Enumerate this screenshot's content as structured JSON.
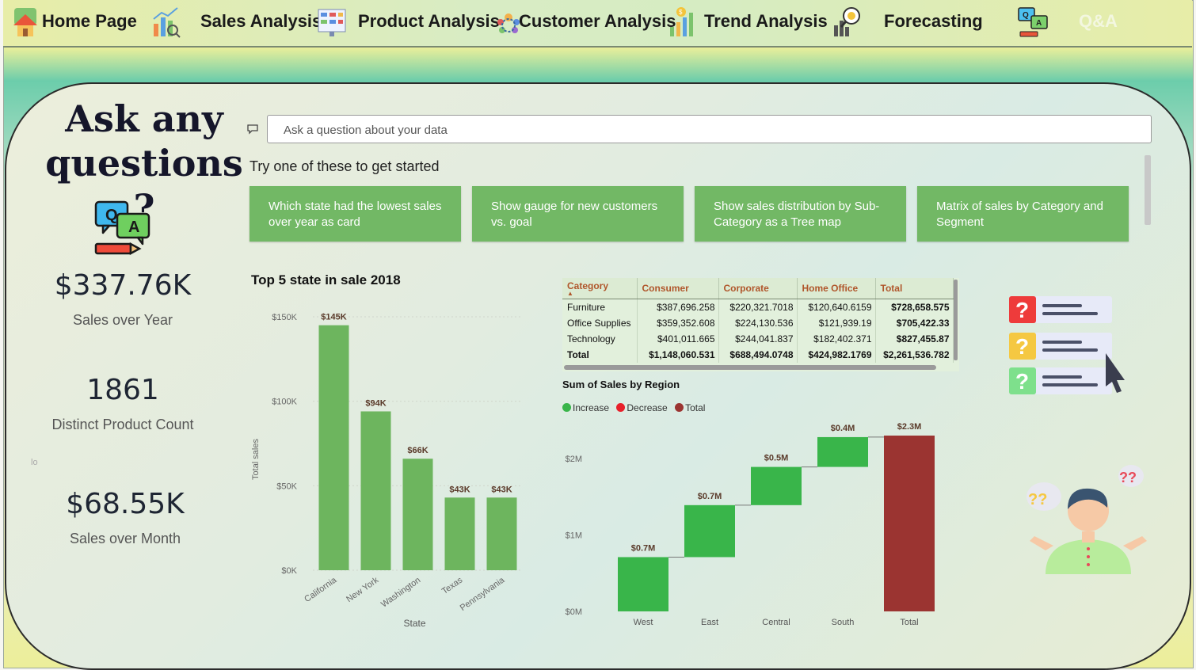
{
  "nav": {
    "items": [
      {
        "label": "Home Page",
        "icon": "house-icon"
      },
      {
        "label": "Sales Analysis",
        "icon": "bar-chart-magnifier-icon"
      },
      {
        "label": "Product Analysis",
        "icon": "product-board-icon"
      },
      {
        "label": "Customer Analysis",
        "icon": "customer-group-icon"
      },
      {
        "label": "Trend Analysis",
        "icon": "trend-chart-icon"
      },
      {
        "label": "Forecasting",
        "icon": "forecast-magnifier-icon"
      },
      {
        "label": "Q&A",
        "icon": "qa-chat-icon"
      }
    ]
  },
  "left": {
    "title_line1": "Ask any",
    "title_line2": "questions ?",
    "kpis": [
      {
        "value": "$337.76K",
        "label": "Sales over Year"
      },
      {
        "value": "1861",
        "label": "Distinct Product Count"
      },
      {
        "value": "$68.55K",
        "label": "Sales over Month"
      }
    ],
    "stray_text": "lo"
  },
  "qa": {
    "placeholder": "Ask a question about your data",
    "try_text": "Try one of these to get started",
    "suggestions": [
      "Which state had the lowest sales over year as card",
      "Show gauge for new customers vs. goal",
      "Show sales distribution by Sub-Category as a Tree map",
      "Matrix of sales by Category and Segment"
    ]
  },
  "colors": {
    "bar_green": "#6db55e",
    "chip_green": "#72b865",
    "increase": "#39b54a",
    "decrease": "#e8202a",
    "total": "#9b3431"
  },
  "chart_data": [
    {
      "type": "bar",
      "title": "Top 5 state in sale 2018",
      "xlabel": "State",
      "ylabel": "Total sales",
      "categories": [
        "California",
        "New York",
        "Washington",
        "Texas",
        "Pennsylvania"
      ],
      "values": [
        145,
        94,
        66,
        43,
        43
      ],
      "value_labels": [
        "$145K",
        "$94K",
        "$66K",
        "$43K",
        "$43K"
      ],
      "yticks": [
        "$0K",
        "$50K",
        "$100K",
        "$150K"
      ],
      "ylim": [
        0,
        150
      ],
      "grid": true
    },
    {
      "type": "table",
      "columns": [
        "Category",
        "Consumer",
        "Corporate",
        "Home Office",
        "Total"
      ],
      "rows": [
        [
          "Furniture",
          "$387,696.258",
          "$220,321.7018",
          "$120,640.6159",
          "$728,658.575"
        ],
        [
          "Office Supplies",
          "$359,352.608",
          "$224,130.536",
          "$121,939.19",
          "$705,422.33"
        ],
        [
          "Technology",
          "$401,011.665",
          "$244,041.837",
          "$182,402.371",
          "$827,455.87"
        ],
        [
          "Total",
          "$1,148,060.531",
          "$688,494.0748",
          "$424,982.1769",
          "$2,261,536.782"
        ]
      ]
    },
    {
      "type": "bar",
      "subtype": "waterfall",
      "title": "Sum of Sales by Region",
      "legend": [
        "Increase",
        "Decrease",
        "Total"
      ],
      "categories": [
        "West",
        "East",
        "Central",
        "South",
        "Total"
      ],
      "values": [
        0.71,
        0.68,
        0.5,
        0.39,
        2.3
      ],
      "value_labels": [
        "$0.7M",
        "$0.7M",
        "$0.5M",
        "$0.4M",
        "$2.3M"
      ],
      "kinds": [
        "increase",
        "increase",
        "increase",
        "increase",
        "total"
      ],
      "yticks": [
        "$0M",
        "$1M",
        "$2M"
      ],
      "ylim": [
        0,
        2.3
      ]
    }
  ]
}
